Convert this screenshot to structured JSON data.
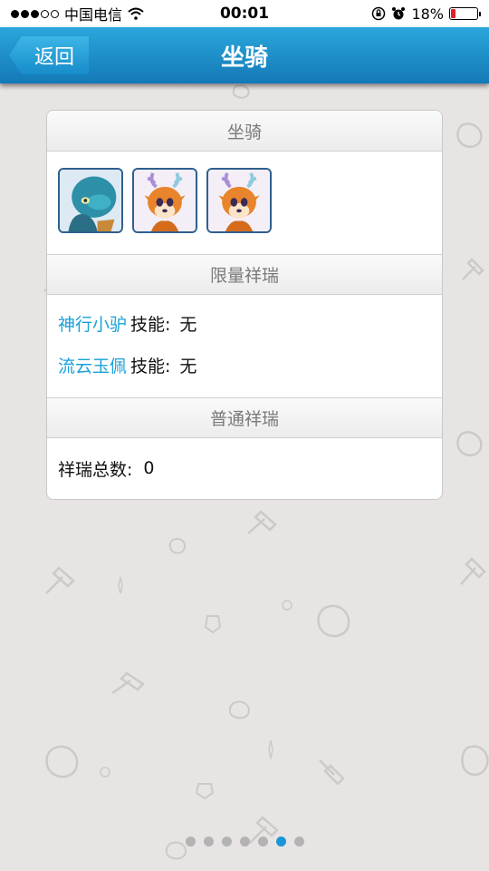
{
  "status_bar": {
    "carrier": "中国电信",
    "time": "00:01",
    "battery_percent": "18%",
    "battery_level": 0.18,
    "battery_color": "#e0202a",
    "signal_dots_full": 3,
    "signal_dots_total": 5,
    "icons": [
      "wifi-icon",
      "rotation-lock-icon",
      "alarm-icon",
      "battery-icon"
    ]
  },
  "nav": {
    "back_label": "返回",
    "title": "坐骑"
  },
  "sections": {
    "mounts_title": "坐骑",
    "mounts": [
      {
        "icon": "blue-creature-icon"
      },
      {
        "icon": "deer-icon"
      },
      {
        "icon": "deer-icon"
      }
    ],
    "limited_title": "限量祥瑞",
    "limited_items": [
      {
        "name": "神行小驴",
        "skill_label": "技能:",
        "skill_value": "无"
      },
      {
        "name": "流云玉佩",
        "skill_label": "技能:",
        "skill_value": "无"
      }
    ],
    "normal_title": "普通祥瑞",
    "total_label": "祥瑞总数:",
    "total_value": "0"
  },
  "pager": {
    "count": 7,
    "active_index": 5,
    "active_color": "#1a96d6"
  }
}
